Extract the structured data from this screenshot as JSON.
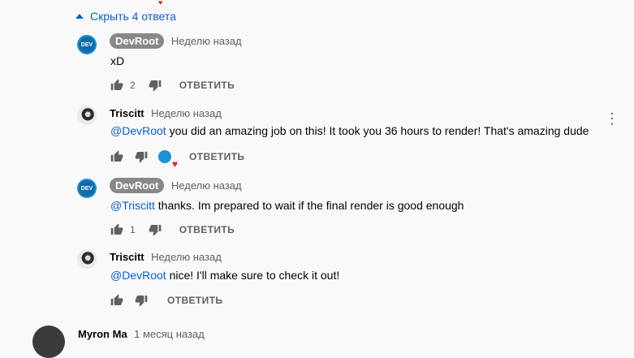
{
  "toggle": {
    "label": "Скрыть 4 ответа",
    "icon": "chevron-up-icon"
  },
  "comments": [
    {
      "author": "DevRoot",
      "time": "Неделю назад",
      "text": "xD",
      "likes": "2",
      "reply": "ОТВЕТИТЬ"
    },
    {
      "author": "Triscitt",
      "time": "Неделю назад",
      "mention": "@DevRoot",
      "text": " you did an amazing job on this! It took you 36 hours to render! That's amazing dude",
      "reply": "ОТВЕТИТЬ",
      "liked_by_creator": true
    },
    {
      "author": "DevRoot",
      "time": "Неделю назад",
      "mention": "@Triscitt",
      "text": " thanks. Im prepared to wait if the final render is good enough",
      "likes": "1",
      "reply": "ОТВЕТИТЬ"
    },
    {
      "author": "Triscitt",
      "time": "Неделю назад",
      "mention": "@DevRoot",
      "text": " nice! I'll make sure to check it out!",
      "reply": "ОТВЕТИТЬ"
    }
  ],
  "next_comment": {
    "author": "Myron Ma",
    "time": "1 месяц назад"
  },
  "colors": {
    "link": "#065fd4",
    "heart": "#e62117",
    "chip": "#888888"
  }
}
